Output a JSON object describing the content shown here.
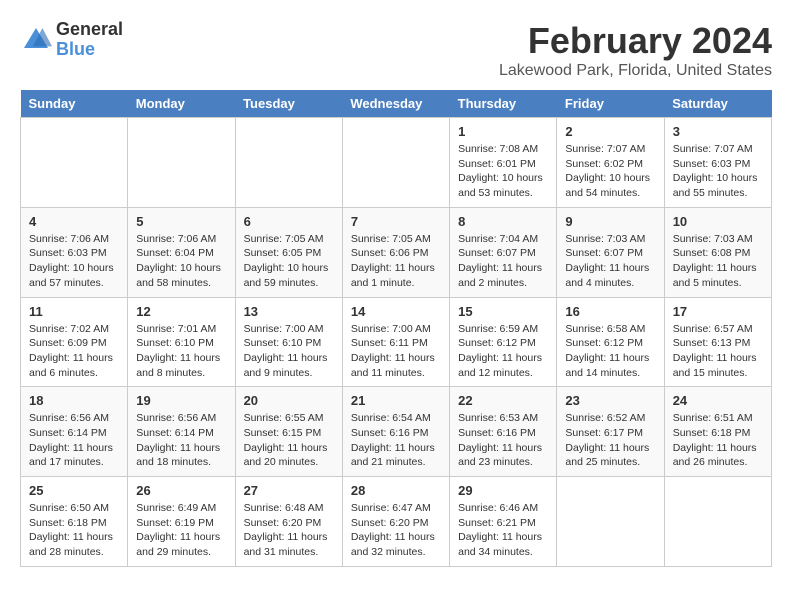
{
  "logo": {
    "line1": "General",
    "line2": "Blue"
  },
  "title": "February 2024",
  "subtitle": "Lakewood Park, Florida, United States",
  "days_of_week": [
    "Sunday",
    "Monday",
    "Tuesday",
    "Wednesday",
    "Thursday",
    "Friday",
    "Saturday"
  ],
  "weeks": [
    [
      {
        "day": "",
        "info": ""
      },
      {
        "day": "",
        "info": ""
      },
      {
        "day": "",
        "info": ""
      },
      {
        "day": "",
        "info": ""
      },
      {
        "day": "1",
        "info": "Sunrise: 7:08 AM\nSunset: 6:01 PM\nDaylight: 10 hours\nand 53 minutes."
      },
      {
        "day": "2",
        "info": "Sunrise: 7:07 AM\nSunset: 6:02 PM\nDaylight: 10 hours\nand 54 minutes."
      },
      {
        "day": "3",
        "info": "Sunrise: 7:07 AM\nSunset: 6:03 PM\nDaylight: 10 hours\nand 55 minutes."
      }
    ],
    [
      {
        "day": "4",
        "info": "Sunrise: 7:06 AM\nSunset: 6:03 PM\nDaylight: 10 hours\nand 57 minutes."
      },
      {
        "day": "5",
        "info": "Sunrise: 7:06 AM\nSunset: 6:04 PM\nDaylight: 10 hours\nand 58 minutes."
      },
      {
        "day": "6",
        "info": "Sunrise: 7:05 AM\nSunset: 6:05 PM\nDaylight: 10 hours\nand 59 minutes."
      },
      {
        "day": "7",
        "info": "Sunrise: 7:05 AM\nSunset: 6:06 PM\nDaylight: 11 hours\nand 1 minute."
      },
      {
        "day": "8",
        "info": "Sunrise: 7:04 AM\nSunset: 6:07 PM\nDaylight: 11 hours\nand 2 minutes."
      },
      {
        "day": "9",
        "info": "Sunrise: 7:03 AM\nSunset: 6:07 PM\nDaylight: 11 hours\nand 4 minutes."
      },
      {
        "day": "10",
        "info": "Sunrise: 7:03 AM\nSunset: 6:08 PM\nDaylight: 11 hours\nand 5 minutes."
      }
    ],
    [
      {
        "day": "11",
        "info": "Sunrise: 7:02 AM\nSunset: 6:09 PM\nDaylight: 11 hours\nand 6 minutes."
      },
      {
        "day": "12",
        "info": "Sunrise: 7:01 AM\nSunset: 6:10 PM\nDaylight: 11 hours\nand 8 minutes."
      },
      {
        "day": "13",
        "info": "Sunrise: 7:00 AM\nSunset: 6:10 PM\nDaylight: 11 hours\nand 9 minutes."
      },
      {
        "day": "14",
        "info": "Sunrise: 7:00 AM\nSunset: 6:11 PM\nDaylight: 11 hours\nand 11 minutes."
      },
      {
        "day": "15",
        "info": "Sunrise: 6:59 AM\nSunset: 6:12 PM\nDaylight: 11 hours\nand 12 minutes."
      },
      {
        "day": "16",
        "info": "Sunrise: 6:58 AM\nSunset: 6:12 PM\nDaylight: 11 hours\nand 14 minutes."
      },
      {
        "day": "17",
        "info": "Sunrise: 6:57 AM\nSunset: 6:13 PM\nDaylight: 11 hours\nand 15 minutes."
      }
    ],
    [
      {
        "day": "18",
        "info": "Sunrise: 6:56 AM\nSunset: 6:14 PM\nDaylight: 11 hours\nand 17 minutes."
      },
      {
        "day": "19",
        "info": "Sunrise: 6:56 AM\nSunset: 6:14 PM\nDaylight: 11 hours\nand 18 minutes."
      },
      {
        "day": "20",
        "info": "Sunrise: 6:55 AM\nSunset: 6:15 PM\nDaylight: 11 hours\nand 20 minutes."
      },
      {
        "day": "21",
        "info": "Sunrise: 6:54 AM\nSunset: 6:16 PM\nDaylight: 11 hours\nand 21 minutes."
      },
      {
        "day": "22",
        "info": "Sunrise: 6:53 AM\nSunset: 6:16 PM\nDaylight: 11 hours\nand 23 minutes."
      },
      {
        "day": "23",
        "info": "Sunrise: 6:52 AM\nSunset: 6:17 PM\nDaylight: 11 hours\nand 25 minutes."
      },
      {
        "day": "24",
        "info": "Sunrise: 6:51 AM\nSunset: 6:18 PM\nDaylight: 11 hours\nand 26 minutes."
      }
    ],
    [
      {
        "day": "25",
        "info": "Sunrise: 6:50 AM\nSunset: 6:18 PM\nDaylight: 11 hours\nand 28 minutes."
      },
      {
        "day": "26",
        "info": "Sunrise: 6:49 AM\nSunset: 6:19 PM\nDaylight: 11 hours\nand 29 minutes."
      },
      {
        "day": "27",
        "info": "Sunrise: 6:48 AM\nSunset: 6:20 PM\nDaylight: 11 hours\nand 31 minutes."
      },
      {
        "day": "28",
        "info": "Sunrise: 6:47 AM\nSunset: 6:20 PM\nDaylight: 11 hours\nand 32 minutes."
      },
      {
        "day": "29",
        "info": "Sunrise: 6:46 AM\nSunset: 6:21 PM\nDaylight: 11 hours\nand 34 minutes."
      },
      {
        "day": "",
        "info": ""
      },
      {
        "day": "",
        "info": ""
      }
    ]
  ]
}
